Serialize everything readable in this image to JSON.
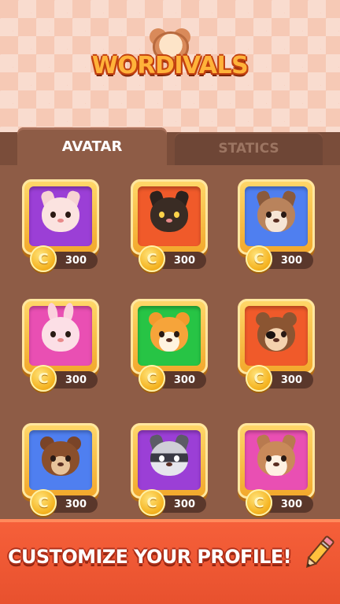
{
  "app": {
    "title": "WORDIVALS"
  },
  "tabs": [
    {
      "label": "AVATAR",
      "active": true
    },
    {
      "label": "STATICS",
      "active": false
    }
  ],
  "currency": {
    "icon": "coin-icon",
    "symbol": "C"
  },
  "avatars": [
    {
      "name": "cat",
      "icon": "white-cat-icon",
      "bg": "#9b3fd6",
      "price": "300"
    },
    {
      "name": "black-cat",
      "icon": "black-cat-icon",
      "bg": "#f05a2a",
      "price": "300"
    },
    {
      "name": "dog",
      "icon": "dog-icon",
      "bg": "#4f7ff0",
      "price": "300"
    },
    {
      "name": "bunny",
      "icon": "bunny-icon",
      "bg": "#e94fb3",
      "price": "300"
    },
    {
      "name": "tiger",
      "icon": "tiger-icon",
      "bg": "#27c445",
      "price": "300"
    },
    {
      "name": "monkey",
      "icon": "pirate-monkey-icon",
      "bg": "#f05a2a",
      "price": "300"
    },
    {
      "name": "bear",
      "icon": "bear-icon",
      "bg": "#4f7ff0",
      "price": "300"
    },
    {
      "name": "raccoon",
      "icon": "raccoon-icon",
      "bg": "#9b3fd6",
      "price": "300"
    },
    {
      "name": "squirrel",
      "icon": "squirrel-icon",
      "bg": "#e94fb3",
      "price": "300"
    }
  ],
  "banner": {
    "text": "CUSTOMIZE YOUR PROFILE!",
    "icon": "pencil-icon"
  }
}
